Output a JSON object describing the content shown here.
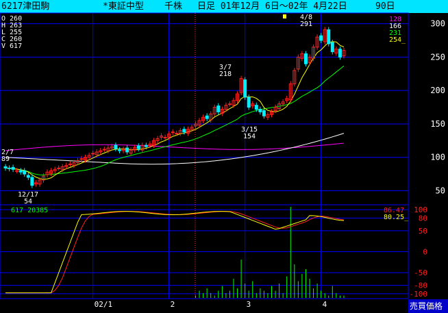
{
  "header": {
    "code_name": "6217津田駒",
    "market": "*東証中型",
    "unit": "千株",
    "period": "日足 01年12月 6日～02年 4月22日",
    "days": "90日"
  },
  "ohlcv": {
    "o": "O 260",
    "h": "H 263",
    "l": "L 255",
    "c": "C 260",
    "v": "V 617"
  },
  "ma_values": [
    "128",
    "166",
    "231",
    "254_"
  ],
  "price_axis": [
    "300",
    "250",
    "200",
    "150",
    "100",
    "50"
  ],
  "annotations": {
    "peak_date": "4/8",
    "peak_value": "291",
    "mar7_date": "3/7",
    "mar7_value": "218",
    "mar15_date": "3/15",
    "mar15_value": "154",
    "dec17_date": "12/17",
    "dec17_value": "54",
    "feb7_date": "2/7",
    "feb7_value": "89"
  },
  "volume_label": "617 20385",
  "osc_values": [
    "86.47",
    "80.25_"
  ],
  "osc_axis": [
    "100",
    "80",
    "50",
    "0",
    "-50",
    "-80",
    "-100"
  ],
  "x_axis": [
    "02/1",
    "2",
    "3",
    "4"
  ],
  "corner_label": "売買価格",
  "colors": {
    "title_bg": "#00e4ff",
    "up_candle": "#ff2020",
    "down_candle": "#00f0ff",
    "ma_short": "#ffff00",
    "ma_mid": "#00ff00",
    "ma_long": "#ffffff",
    "ma_xlong": "#ff00ff",
    "grid": "#0000ff",
    "volume": "#00ff00",
    "osc_fast": "#ffff00",
    "osc_slow": "#ff2020"
  },
  "chart_data": {
    "type": "candlestick",
    "price_ylim": [
      30,
      315
    ],
    "osc_ylim": [
      -110,
      110
    ],
    "month_starts": [
      23,
      43,
      63,
      83
    ],
    "closes": [
      84,
      83,
      82,
      80,
      78,
      75,
      70,
      58,
      62,
      66,
      72,
      78,
      80,
      82,
      84,
      86,
      88,
      90,
      92,
      95,
      98,
      100,
      103,
      106,
      108,
      110,
      112,
      114,
      116,
      113,
      110,
      112,
      108,
      111,
      115,
      113,
      118,
      116,
      120,
      125,
      128,
      132,
      130,
      135,
      138,
      136,
      140,
      138,
      142,
      145,
      150,
      155,
      160,
      158,
      165,
      175,
      168,
      172,
      178,
      180,
      185,
      195,
      218,
      190,
      175,
      180,
      172,
      168,
      162,
      164,
      168,
      175,
      180,
      183,
      188,
      210,
      230,
      250,
      255,
      240,
      250,
      265,
      280,
      275,
      291,
      270,
      258,
      262,
      250,
      260
    ],
    "volumes": [
      0,
      0,
      0,
      0,
      0,
      0,
      0,
      0,
      0,
      0,
      0,
      0,
      0,
      0,
      0,
      0,
      0,
      0,
      0,
      0,
      0,
      0,
      0,
      0,
      0,
      0,
      0,
      0,
      0,
      0,
      0,
      0,
      0,
      0,
      0,
      0,
      0,
      0,
      0,
      0,
      0,
      0,
      0,
      0,
      0,
      0,
      0,
      0,
      0,
      0,
      1,
      3,
      2,
      4,
      2,
      1,
      3,
      5,
      2,
      3,
      8,
      4,
      16,
      6,
      3,
      7,
      2,
      4,
      3,
      2,
      5,
      3,
      6,
      2,
      9,
      38,
      14,
      7,
      10,
      12,
      8,
      4,
      6,
      3,
      2,
      1,
      5,
      2,
      1,
      1
    ]
  }
}
